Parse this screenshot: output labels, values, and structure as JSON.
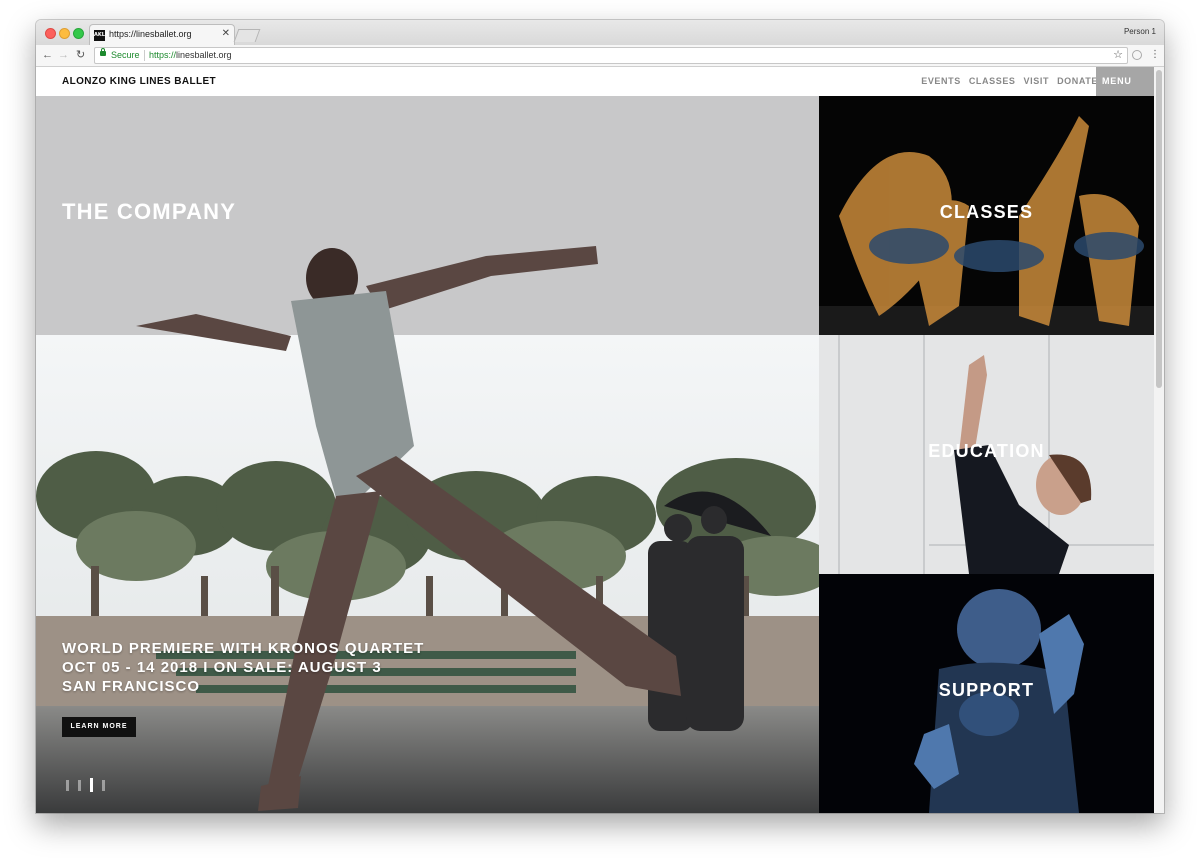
{
  "browser": {
    "tab_title": "https://linesballet.org",
    "favicon_text": "AKLB",
    "profile": "Person 1",
    "secure_label": "Secure",
    "url_scheme": "https://",
    "url_host": "linesballet.org"
  },
  "site": {
    "logo": "ALONZO KING LINES BALLET",
    "nav": [
      "EVENTS",
      "CLASSES",
      "VISIT",
      "DONATE"
    ],
    "menu": "MENU"
  },
  "hero": {
    "title": "THE COMPANY",
    "promo_lines": [
      "WORLD PREMIERE WITH KRONOS QUARTET",
      "OCT 05 - 14 2018 I ON SALE: AUGUST 3",
      "SAN FRANCISCO"
    ],
    "cta": "LEARN MORE",
    "slides": 4,
    "active_slide": 3
  },
  "tiles": [
    {
      "label": "CLASSES"
    },
    {
      "label": "EDUCATION"
    },
    {
      "label": "SUPPORT"
    }
  ],
  "colors": {
    "menu_bg": "#a6a6a6",
    "secure_green": "#1d8a2e"
  }
}
